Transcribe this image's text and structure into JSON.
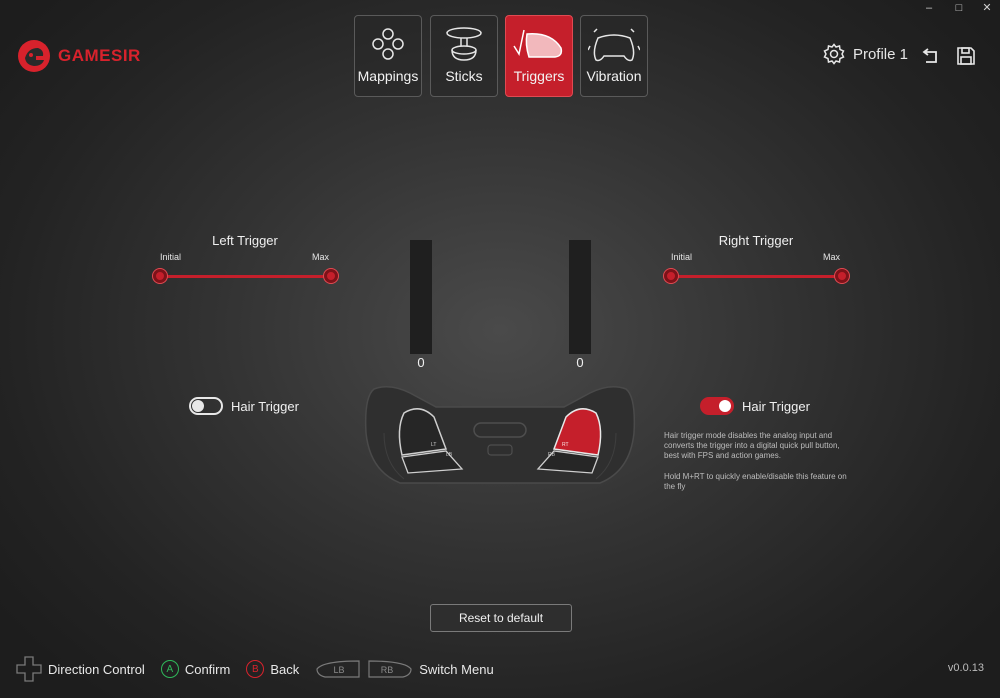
{
  "window": {
    "minimize": "–",
    "maximize": "□",
    "close": "✕"
  },
  "brand": {
    "name": "GAMESIR"
  },
  "tabs": [
    {
      "label": "Mappings",
      "icon": "dpad-icon",
      "active": false
    },
    {
      "label": "Sticks",
      "icon": "joystick-icon",
      "active": false
    },
    {
      "label": "Triggers",
      "icon": "trigger-icon",
      "active": true
    },
    {
      "label": "Vibration",
      "icon": "vibration-controller-icon",
      "active": false
    }
  ],
  "profile": {
    "label": "Profile 1",
    "settings_icon": "gear-icon",
    "undo_icon": "undo-icon",
    "save_icon": "save-icon"
  },
  "left_trigger": {
    "title": "Left Trigger",
    "initial_label": "Initial",
    "max_label": "Max",
    "value": "0",
    "hair_trigger_label": "Hair Trigger",
    "hair_trigger_on": false
  },
  "right_trigger": {
    "title": "Right Trigger",
    "initial_label": "Initial",
    "max_label": "Max",
    "value": "0",
    "hair_trigger_label": "Hair Trigger",
    "hair_trigger_on": true,
    "description_1": "Hair trigger mode disables the analog input and converts the trigger into a digital quick pull button, best with FPS and action games.",
    "description_2": "Hold M+RT to quickly enable/disable this feature on the fly"
  },
  "controller": {
    "lt": "LT",
    "lb": "LB",
    "rt": "RT",
    "rb": "RB"
  },
  "reset_label": "Reset to default",
  "hints": {
    "direction": "Direction Control",
    "confirm_key": "A",
    "confirm": "Confirm",
    "back_key": "B",
    "back": "Back",
    "lb_key": "LB",
    "rb_key": "RB",
    "switch": "Switch Menu"
  },
  "version": "v0.0.13",
  "colors": {
    "accent": "#c51f2b",
    "background": "#2b2b2b"
  }
}
